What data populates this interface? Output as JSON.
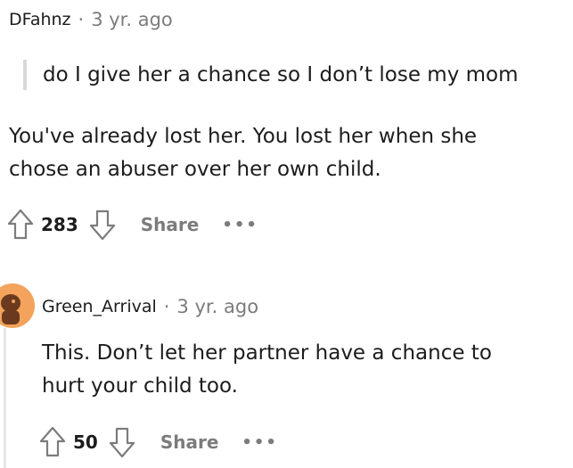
{
  "comments": [
    {
      "author": "DFahnz",
      "separator": "·",
      "time": "3 yr. ago",
      "quote": "do I give her a chance so I don’t lose my mom",
      "body_line1": "You've already lost her. You lost her when she",
      "body_line2": "chose an abuser over her own child.",
      "votes": "283",
      "share_label": "Share",
      "more_label": "•••"
    },
    {
      "author": "Green_Arrival",
      "separator": "·",
      "time": "3 yr. ago",
      "body_line1": "This. Don’t let her partner have a chance to",
      "body_line2": "hurt your child too.",
      "votes": "50",
      "share_label": "Share",
      "more_label": "•••"
    }
  ],
  "colors": {
    "text": "#1c1c1c",
    "muted": "#7c7c7c",
    "quote_bar": "#d8d8d8",
    "avatar_bg": "#f3a35b",
    "avatar_figure": "#6b3a1e"
  },
  "icons": [
    "upvote-icon",
    "downvote-icon",
    "avatar-icon"
  ]
}
